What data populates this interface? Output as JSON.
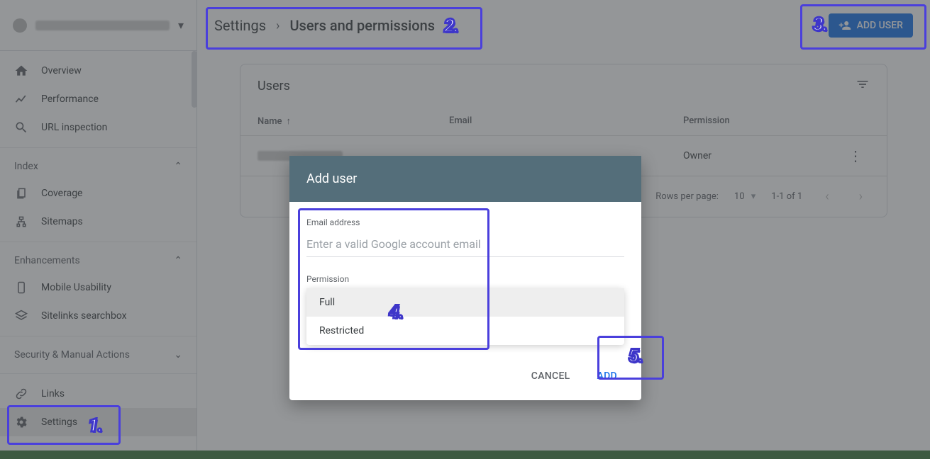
{
  "sidebar": {
    "groups": {
      "primary": [
        {
          "label": "Overview",
          "icon": "home"
        },
        {
          "label": "Performance",
          "icon": "trend"
        },
        {
          "label": "URL inspection",
          "icon": "search"
        }
      ],
      "index_heading": "Index",
      "index": [
        {
          "label": "Coverage",
          "icon": "copy"
        },
        {
          "label": "Sitemaps",
          "icon": "sitemap"
        }
      ],
      "enh_heading": "Enhancements",
      "enhancements": [
        {
          "label": "Mobile Usability",
          "icon": "phone"
        },
        {
          "label": "Sitelinks searchbox",
          "icon": "layers"
        }
      ],
      "security_heading": "Security & Manual Actions",
      "footer": [
        {
          "label": "Links",
          "icon": "links"
        },
        {
          "label": "Settings",
          "icon": "gear"
        }
      ]
    }
  },
  "breadcrumb": {
    "root": "Settings",
    "current": "Users and permissions"
  },
  "buttons": {
    "add_user": "ADD USER"
  },
  "card": {
    "title": "Users",
    "columns": {
      "name": "Name",
      "email": "Email",
      "permission": "Permission"
    },
    "rows": [
      {
        "permission": "Owner"
      }
    ],
    "footer": {
      "rows_label": "Rows per page:",
      "rows_value": "10",
      "range": "1-1 of 1"
    }
  },
  "modal": {
    "title": "Add user",
    "email_label": "Email address",
    "email_placeholder": "Enter a valid Google account email",
    "permission_label": "Permission",
    "options": [
      "Full",
      "Restricted"
    ],
    "cancel": "CANCEL",
    "add": "ADD"
  },
  "annotations": [
    "1.",
    "2.",
    "3.",
    "4.",
    "5."
  ]
}
